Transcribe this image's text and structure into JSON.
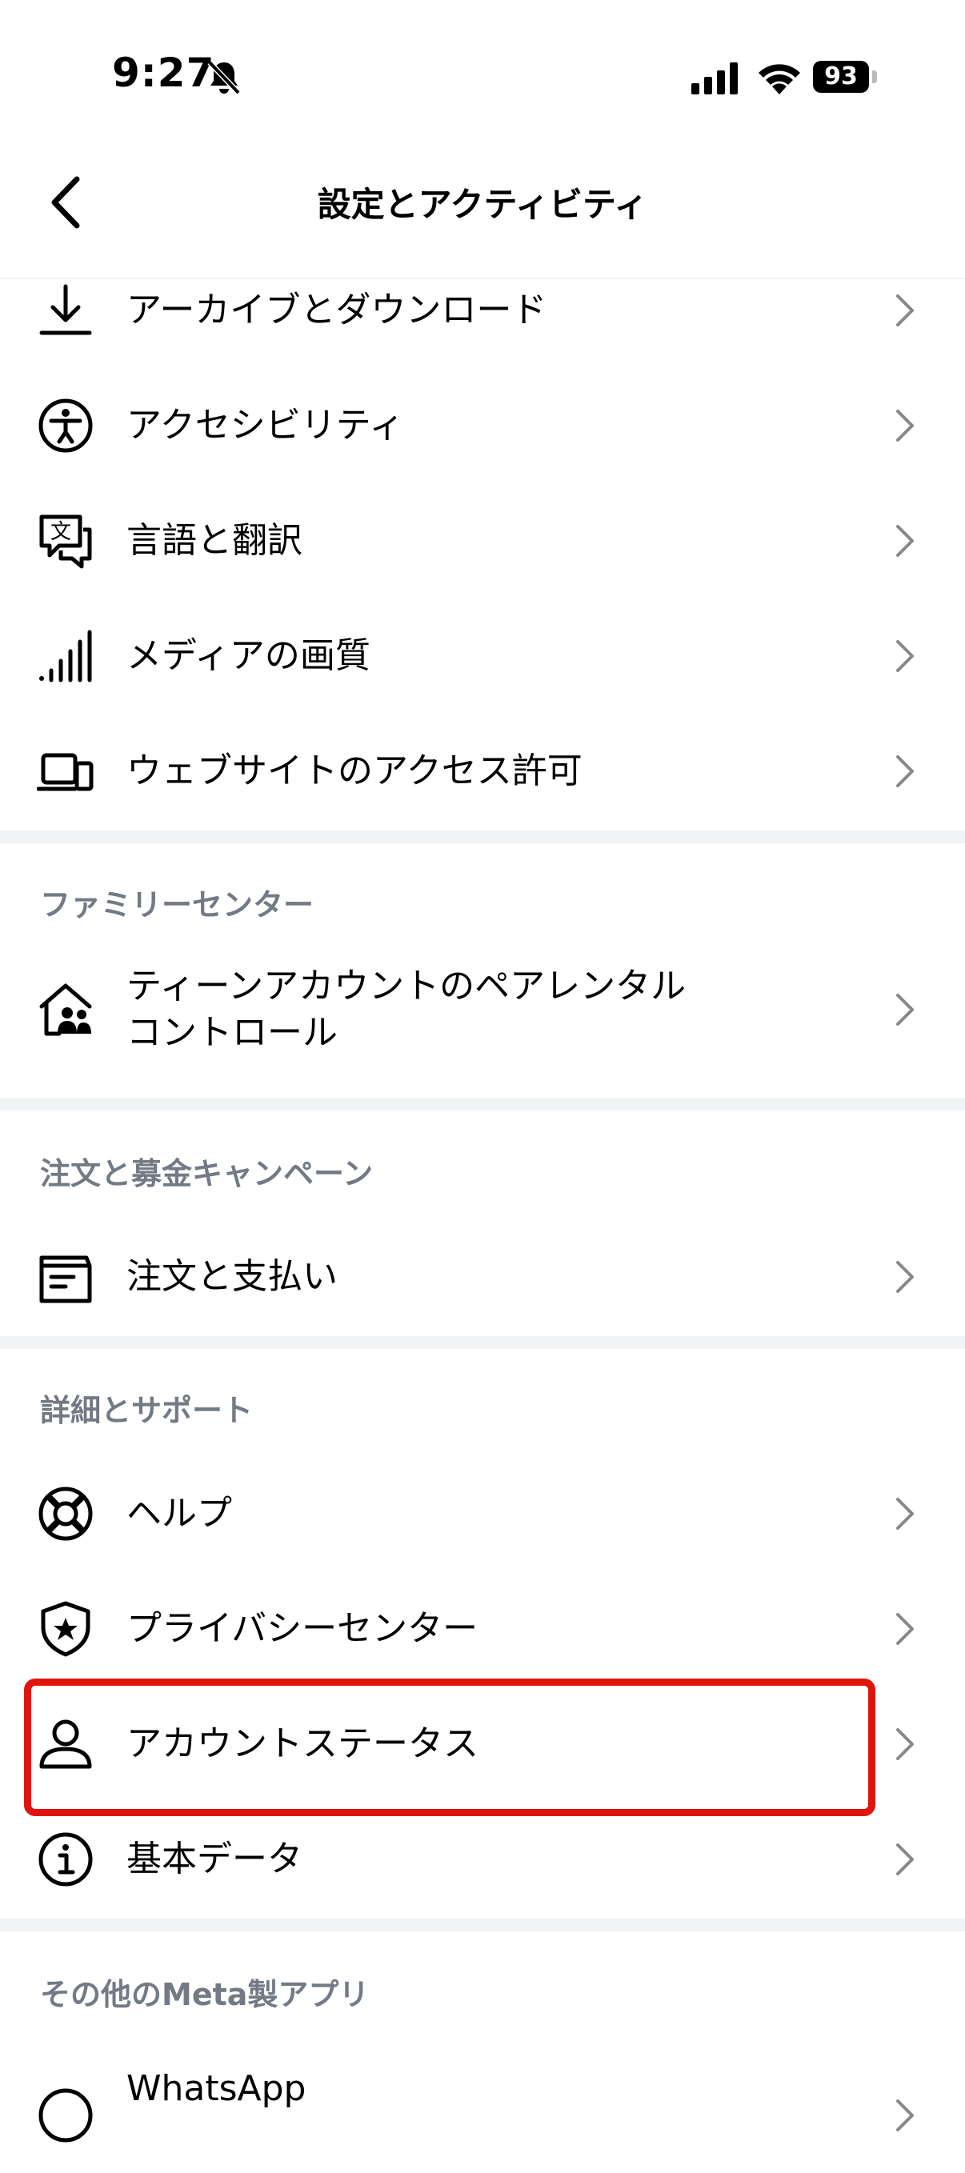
{
  "status_bar": {
    "time": "9:27",
    "battery": "93"
  },
  "header": {
    "title": "設定とアクティビティ"
  },
  "group1": {
    "items": [
      {
        "icon": "download-icon",
        "label": "アーカイブとダウンロード"
      },
      {
        "icon": "accessibility-icon",
        "label": "アクセシビリティ"
      },
      {
        "icon": "translate-icon",
        "label": "言語と翻訳"
      },
      {
        "icon": "signal-bars-icon",
        "label": "メディアの画質"
      },
      {
        "icon": "devices-icon",
        "label": "ウェブサイトのアクセス許可"
      }
    ]
  },
  "family_center": {
    "header": "ファミリーセンター",
    "items": [
      {
        "icon": "family-home-icon",
        "label_line1": "ティーンアカウントのペアレンタル",
        "label_line2": "コントロール"
      }
    ]
  },
  "orders": {
    "header": "注文と募金キャンペーン",
    "items": [
      {
        "icon": "receipt-box-icon",
        "label": "注文と支払い"
      }
    ]
  },
  "support": {
    "header": "詳細とサポート",
    "items": [
      {
        "icon": "lifebuoy-icon",
        "label": "ヘルプ"
      },
      {
        "icon": "shield-star-icon",
        "label": "プライバシーセンター"
      },
      {
        "icon": "person-icon",
        "label": "アカウントステータス"
      },
      {
        "icon": "info-icon",
        "label": "基本データ"
      }
    ]
  },
  "meta_apps": {
    "header": "その他のMeta製アプリ",
    "items": [
      {
        "icon": "whatsapp-icon",
        "label": "WhatsApp"
      }
    ]
  },
  "colors": {
    "highlight": "#e0140c",
    "section_header": "#737a85",
    "divider": "#f2f3f5"
  }
}
